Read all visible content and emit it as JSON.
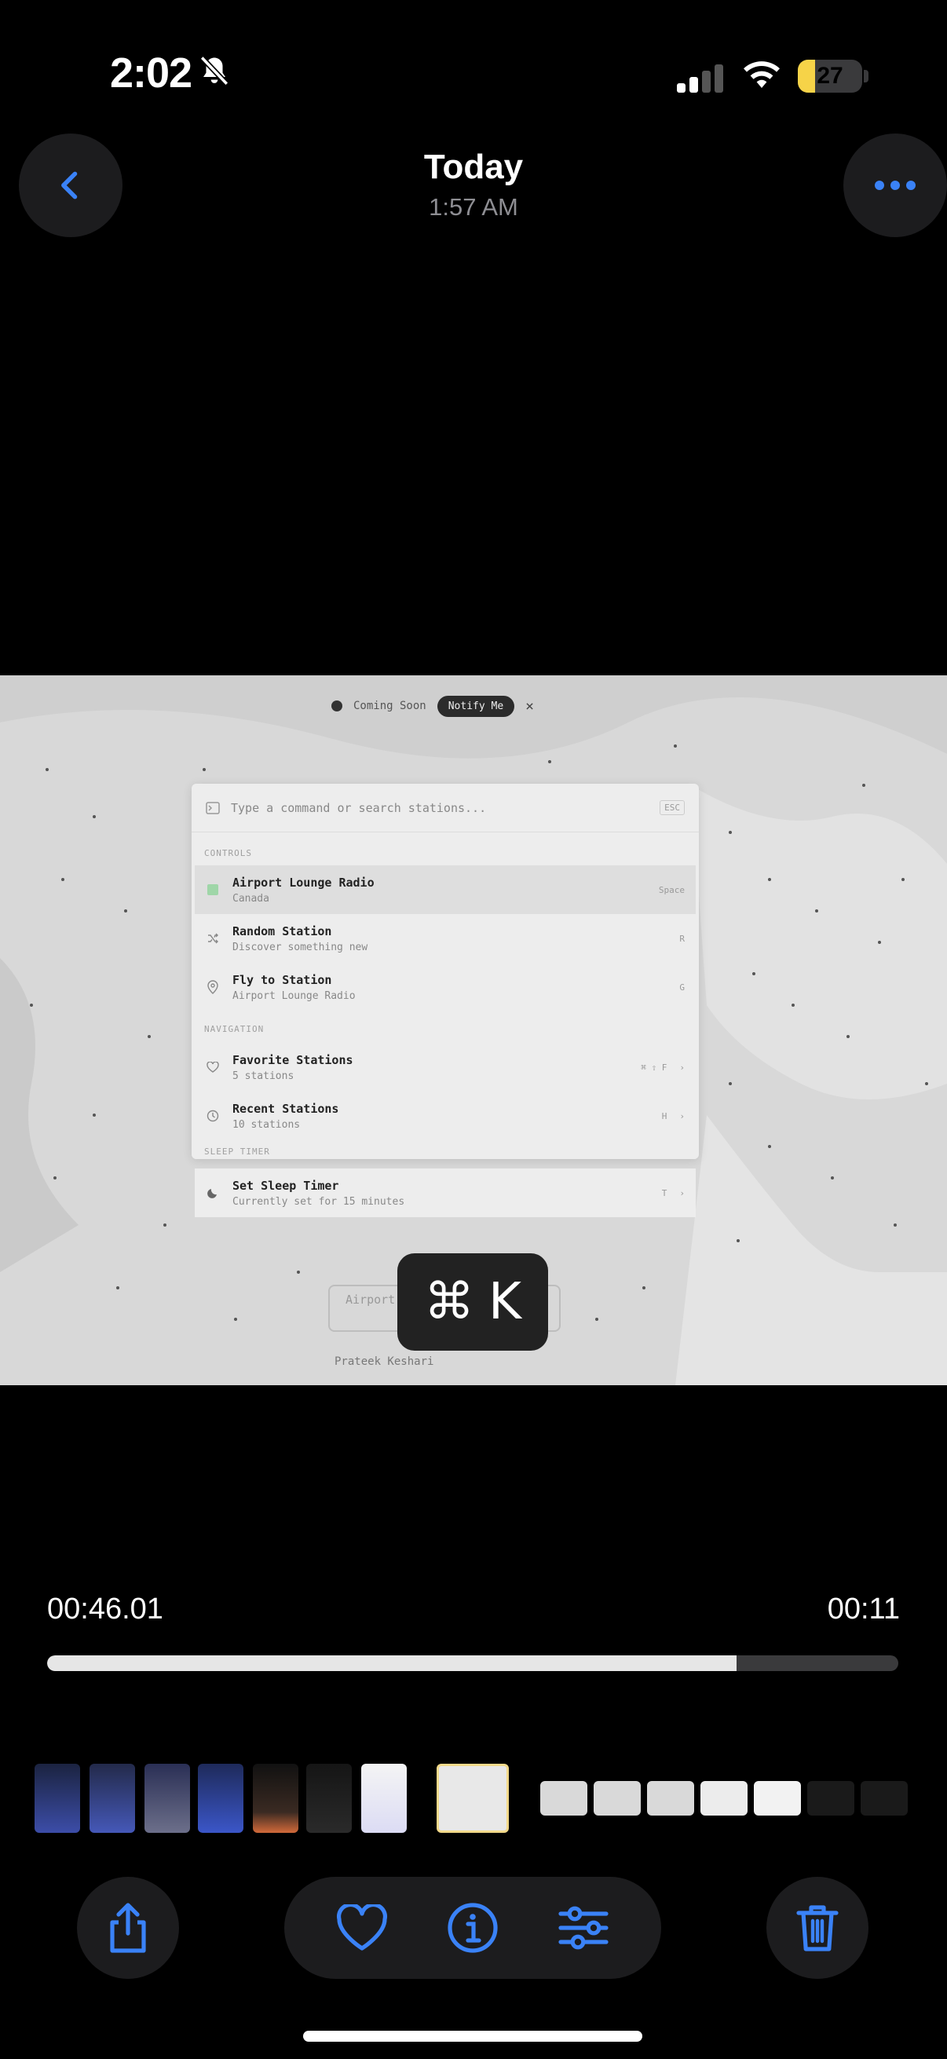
{
  "status_bar": {
    "time": "2:02",
    "battery": "27",
    "battery_level": 0.27,
    "icons": [
      "bell-slash-icon",
      "cellular-signal-icon",
      "wifi-icon",
      "battery-icon"
    ]
  },
  "header": {
    "title": "Today",
    "subtitle": "1:57 AM",
    "icons": [
      "chevron-left-icon",
      "ellipsis-icon"
    ]
  },
  "video": {
    "banner": {
      "text": "Coming Soon",
      "button": "Notify Me",
      "close": "×"
    },
    "palette": {
      "search_placeholder": "Type a command or search stations...",
      "esc": "ESC",
      "sections": {
        "controls": "CONTROLS",
        "navigation": "NAVIGATION",
        "sleep_timer": "SLEEP TIMER"
      },
      "items": [
        {
          "title": "Airport Lounge Radio",
          "subtitle": "Canada",
          "shortcut": "Space",
          "icon": "play-square-icon"
        },
        {
          "title": "Random Station",
          "subtitle": "Discover something new",
          "shortcut": "R",
          "icon": "shuffle-icon"
        },
        {
          "title": "Fly to Station",
          "subtitle": "Airport Lounge Radio",
          "shortcut": "G",
          "icon": "location-pin-icon"
        },
        {
          "title": "Favorite Stations",
          "subtitle": "5 stations",
          "shortcut": "⌘ ⇧ F",
          "icon": "heart-icon"
        },
        {
          "title": "Recent Stations",
          "subtitle": "10 stations",
          "shortcut": "H",
          "icon": "clock-icon"
        },
        {
          "title": "Set Sleep Timer",
          "subtitle": "Currently set for 15 minutes",
          "shortcut": "T",
          "icon": "moon-icon"
        }
      ]
    },
    "overlay_key": {
      "symbol": "⌘",
      "key": "K"
    },
    "ghost_label": "Airport",
    "footer_credit": "Prateek Keshari"
  },
  "scrubber": {
    "elapsed": "00:46.01",
    "remaining": "00:11",
    "progress": 0.81
  },
  "toolbar": {
    "icons": [
      "share-icon",
      "heart-icon",
      "info-icon",
      "adjustments-icon",
      "trash-icon"
    ]
  },
  "colors": {
    "accent": "#3a82f7",
    "battery": "#f6d348",
    "background": "#000000",
    "button_bg": "#1c1c1e"
  }
}
